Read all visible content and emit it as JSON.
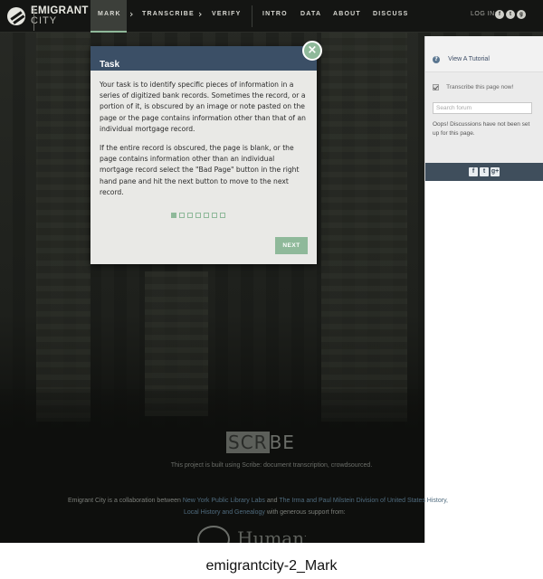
{
  "header": {
    "logo_line1": "EMIGRANT",
    "logo_line2": "CITY",
    "nav": {
      "mark": "MARK",
      "transcribe": "TRANSCRIBE",
      "verify": "VERIFY",
      "intro": "INTRO",
      "data": "DATA",
      "about": "ABOUT",
      "discuss": "DISCUSS"
    },
    "chevron": "›",
    "login_label": "LOG IN:",
    "login_providers": [
      "f",
      "t",
      "g"
    ]
  },
  "modal": {
    "title": "Task",
    "close_glyph": "×",
    "paragraphs": [
      "Your task is to identify specific pieces of information in a series of digitized bank records. Sometimes the record, or a portion of it, is obscured by an image or note pasted on the page or the page contains information other than that of an individual mortgage record.",
      "If the entire record is obscured, the page is blank, or the page contains information other than an individual mortgage record select the \"Bad Page\" button in the right hand pane and hit the next button to move to the next record."
    ],
    "page_count": 7,
    "current_page": 1,
    "next_label": "NEXT"
  },
  "right_panel": {
    "tutorial_icon": "?",
    "tutorial_label": "View A Tutorial",
    "transcribe_checkbox_label": "Transcribe this page now!",
    "search_placeholder": "Search forum",
    "discussion_message": "Oops! Discussions have not been set up for this page.",
    "share_icons": [
      "f",
      "t",
      "g+"
    ]
  },
  "footer": {
    "scribe_logo_a": "SCR",
    "scribe_logo_b": "BE",
    "scribe_tagline": "This project is built using Scribe: document transcription, crowdsourced.",
    "collab_prefix": "Emigrant City is a collaboration between",
    "collab_org1": "New York Public Library Labs",
    "collab_and": "and",
    "collab_org2": "The Irma and Paul Milstein Division of United States History,",
    "collab_org2_cont": "Local History and Genealogy",
    "collab_support": "with generous support from:",
    "neh_word": "Humanities"
  },
  "caption": "emigrantcity-2_Mark",
  "colors": {
    "accent": "#8fb99a",
    "modal_header": "#3b4f66",
    "topbar": "#141513",
    "share_bar": "#3f4e5c"
  }
}
